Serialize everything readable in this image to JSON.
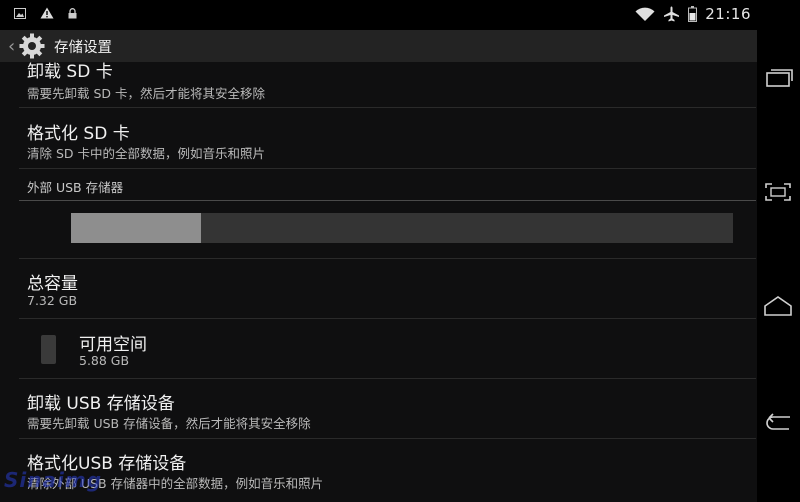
{
  "status_bar": {
    "time": "21:16",
    "icons": [
      "image-notification-icon",
      "warning-icon",
      "lock-icon",
      "wifi-icon",
      "airplane-icon",
      "battery-icon"
    ]
  },
  "action_bar": {
    "title": "存储设置"
  },
  "items": {
    "unmount_sd": {
      "title": "卸载 SD 卡",
      "subtitle": "需要先卸载 SD 卡，然后才能将其安全移除"
    },
    "format_sd": {
      "title": "格式化 SD 卡",
      "subtitle": "清除 SD 卡中的全部数据，例如音乐和照片"
    },
    "section_usb": {
      "title": "外部 USB 存储器"
    },
    "usage_bar": {
      "used_fraction": 0.197
    },
    "total_capacity": {
      "title": "总容量",
      "value": "7.32 GB"
    },
    "available_space": {
      "title": "可用空间",
      "value": "5.88 GB"
    },
    "unmount_usb": {
      "title": "卸载 USB 存储设备",
      "subtitle": "需要先卸载 USB 存储设备，然后才能将其安全移除"
    },
    "format_usb": {
      "title": "格式化USB 存储设备",
      "subtitle": "清除外部 USB 存储器中的全部数据，例如音乐和照片"
    }
  },
  "colors": {
    "background": "#0f0f10",
    "action_bar": "#232323",
    "bar_fill": "#8e8e8e",
    "bar_track": "#343434"
  }
}
